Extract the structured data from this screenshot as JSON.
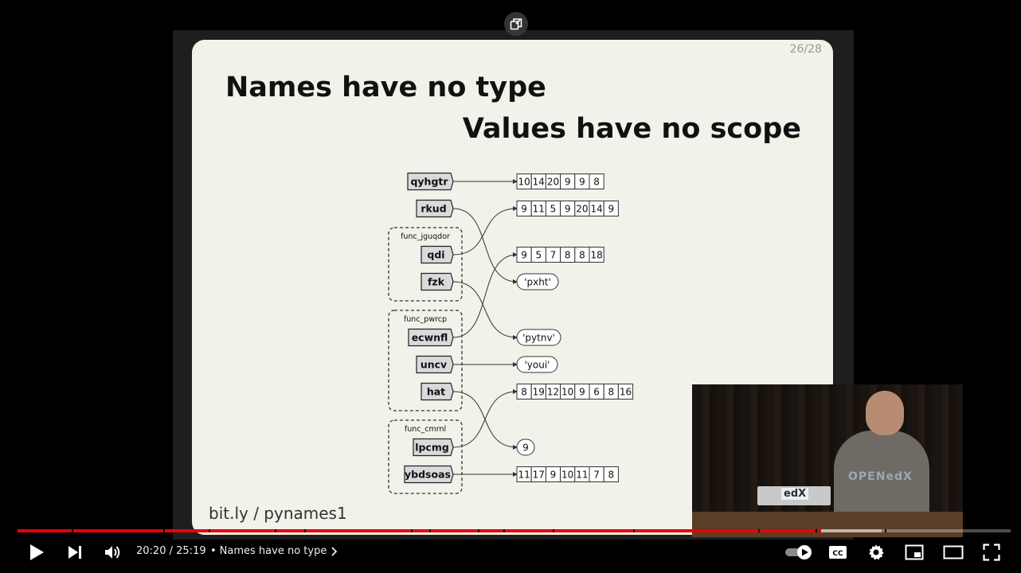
{
  "slide": {
    "page": "26/28",
    "title": "Names have no type",
    "subtitle": "Values have no scope",
    "footer": "bit.ly / pynames1"
  },
  "diagram": {
    "names": [
      "qyhgtr",
      "rkud",
      "qdi",
      "fzk",
      "ecwnfl",
      "uncv",
      "hat",
      "lpcmg",
      "ybdsoas"
    ],
    "frames": [
      "func_jguqdor",
      "func_pwrcp",
      "func_cmrnl"
    ],
    "lists": [
      [
        "10",
        "14",
        "20",
        "9",
        "9",
        "8"
      ],
      [
        "9",
        "11",
        "5",
        "9",
        "20",
        "14",
        "9"
      ],
      [
        "9",
        "5",
        "7",
        "8",
        "8",
        "18"
      ],
      [
        "8",
        "19",
        "12",
        "10",
        "9",
        "6",
        "8",
        "16"
      ],
      [
        "11",
        "17",
        "9",
        "10",
        "11",
        "7",
        "8"
      ]
    ],
    "scalars": [
      "'pxht'",
      "'pytnv'",
      "'youi'",
      "9"
    ]
  },
  "webcam": {
    "shirt_text": "OPENedX",
    "laptop_text": "edX"
  },
  "player": {
    "progress_fraction": 0.8091,
    "buffer_fraction": 0.87,
    "current_time": "20:20",
    "duration": "25:19",
    "time_sep": "/",
    "chapter_bullet": "•",
    "chapter_title": "Names have no type"
  },
  "colors": {
    "progress": "#ff0000",
    "slide_bg": "#f2f1ea",
    "box_fill": "#d9dadc"
  },
  "icons": {
    "copy": "copy-link-icon",
    "play": "play-icon",
    "next": "next-icon",
    "volume": "volume-icon",
    "chevron": "chevron-right-icon",
    "autoplay": "autoplay-toggle-icon",
    "cc": "closed-captions-icon",
    "settings": "gear-icon",
    "miniplayer": "miniplayer-icon",
    "theater": "theater-mode-icon",
    "fullscreen": "fullscreen-icon"
  }
}
